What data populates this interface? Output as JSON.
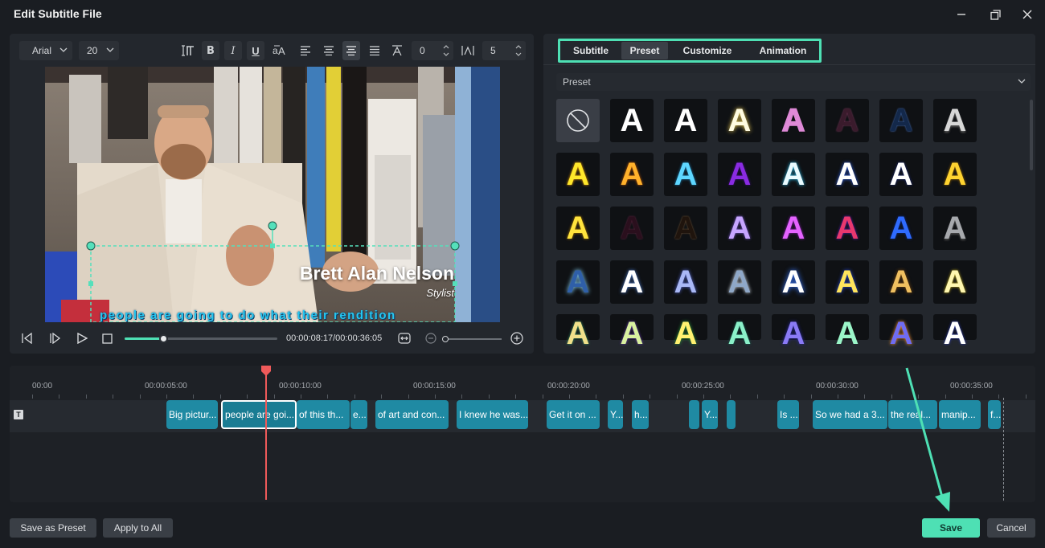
{
  "window": {
    "title": "Edit Subtitle File"
  },
  "toolbar": {
    "font": "Arial",
    "size": "20",
    "spacing_value": "0",
    "line_value": "5"
  },
  "video": {
    "name_title": "Brett Alan Nelson",
    "name_role": "Stylist",
    "subtitle": "people are going to do what their rendition"
  },
  "playback": {
    "timecode": "00:00:08:17/00:00:36:05",
    "progress": 0.26
  },
  "tabs": [
    {
      "label": "Subtitle",
      "active": false
    },
    {
      "label": "Preset",
      "active": true
    },
    {
      "label": "Customize",
      "active": false
    },
    {
      "label": "Animation",
      "active": false
    }
  ],
  "preset": {
    "dropdown_label": "Preset",
    "styles": [
      "none",
      "white",
      "white-bold",
      "white-glow",
      "pink-outline",
      "maroon-outline",
      "blue-outline",
      "silver",
      "yellow",
      "orange",
      "cyan",
      "purple",
      "white-cyan",
      "white-blue",
      "white-navy",
      "gold",
      "yellow-bright",
      "dark-maroon",
      "dark-brown",
      "lavender",
      "magenta",
      "magenta-red",
      "royal-blue",
      "gray",
      "blue-glow",
      "blue-white",
      "periwinkle",
      "steel",
      "blue-white-glow",
      "yellow-blue",
      "gold-brown",
      "yellow-outline",
      "multi-1",
      "multi-2",
      "multi-3",
      "teal",
      "indigo",
      "mint",
      "cobalt",
      "navy-white"
    ]
  },
  "timeline": {
    "ruler": [
      "00:00",
      "00:00:05:00",
      "00:00:10:00",
      "00:00:15:00",
      "00:00:20:00",
      "00:00:25:00",
      "00:00:30:00",
      "00:00:35:00"
    ],
    "track_icon": "T",
    "clips": [
      "Big pictur...",
      "people are goi...",
      "of this th...",
      "e...",
      "of art and con...",
      "I knew he was...",
      "Get it on ...",
      "Y...",
      "h...",
      "",
      "Y...",
      "",
      "Is ...",
      "So we had a 3...",
      "the real...",
      "manip...",
      "f..."
    ]
  },
  "footer": {
    "save_preset": "Save as Preset",
    "apply_all": "Apply to All",
    "save": "Save",
    "cancel": "Cancel"
  },
  "colors": {
    "accent": "#4ee0b4",
    "clip": "#1f8aa3",
    "playhead": "#ef5a5a"
  }
}
